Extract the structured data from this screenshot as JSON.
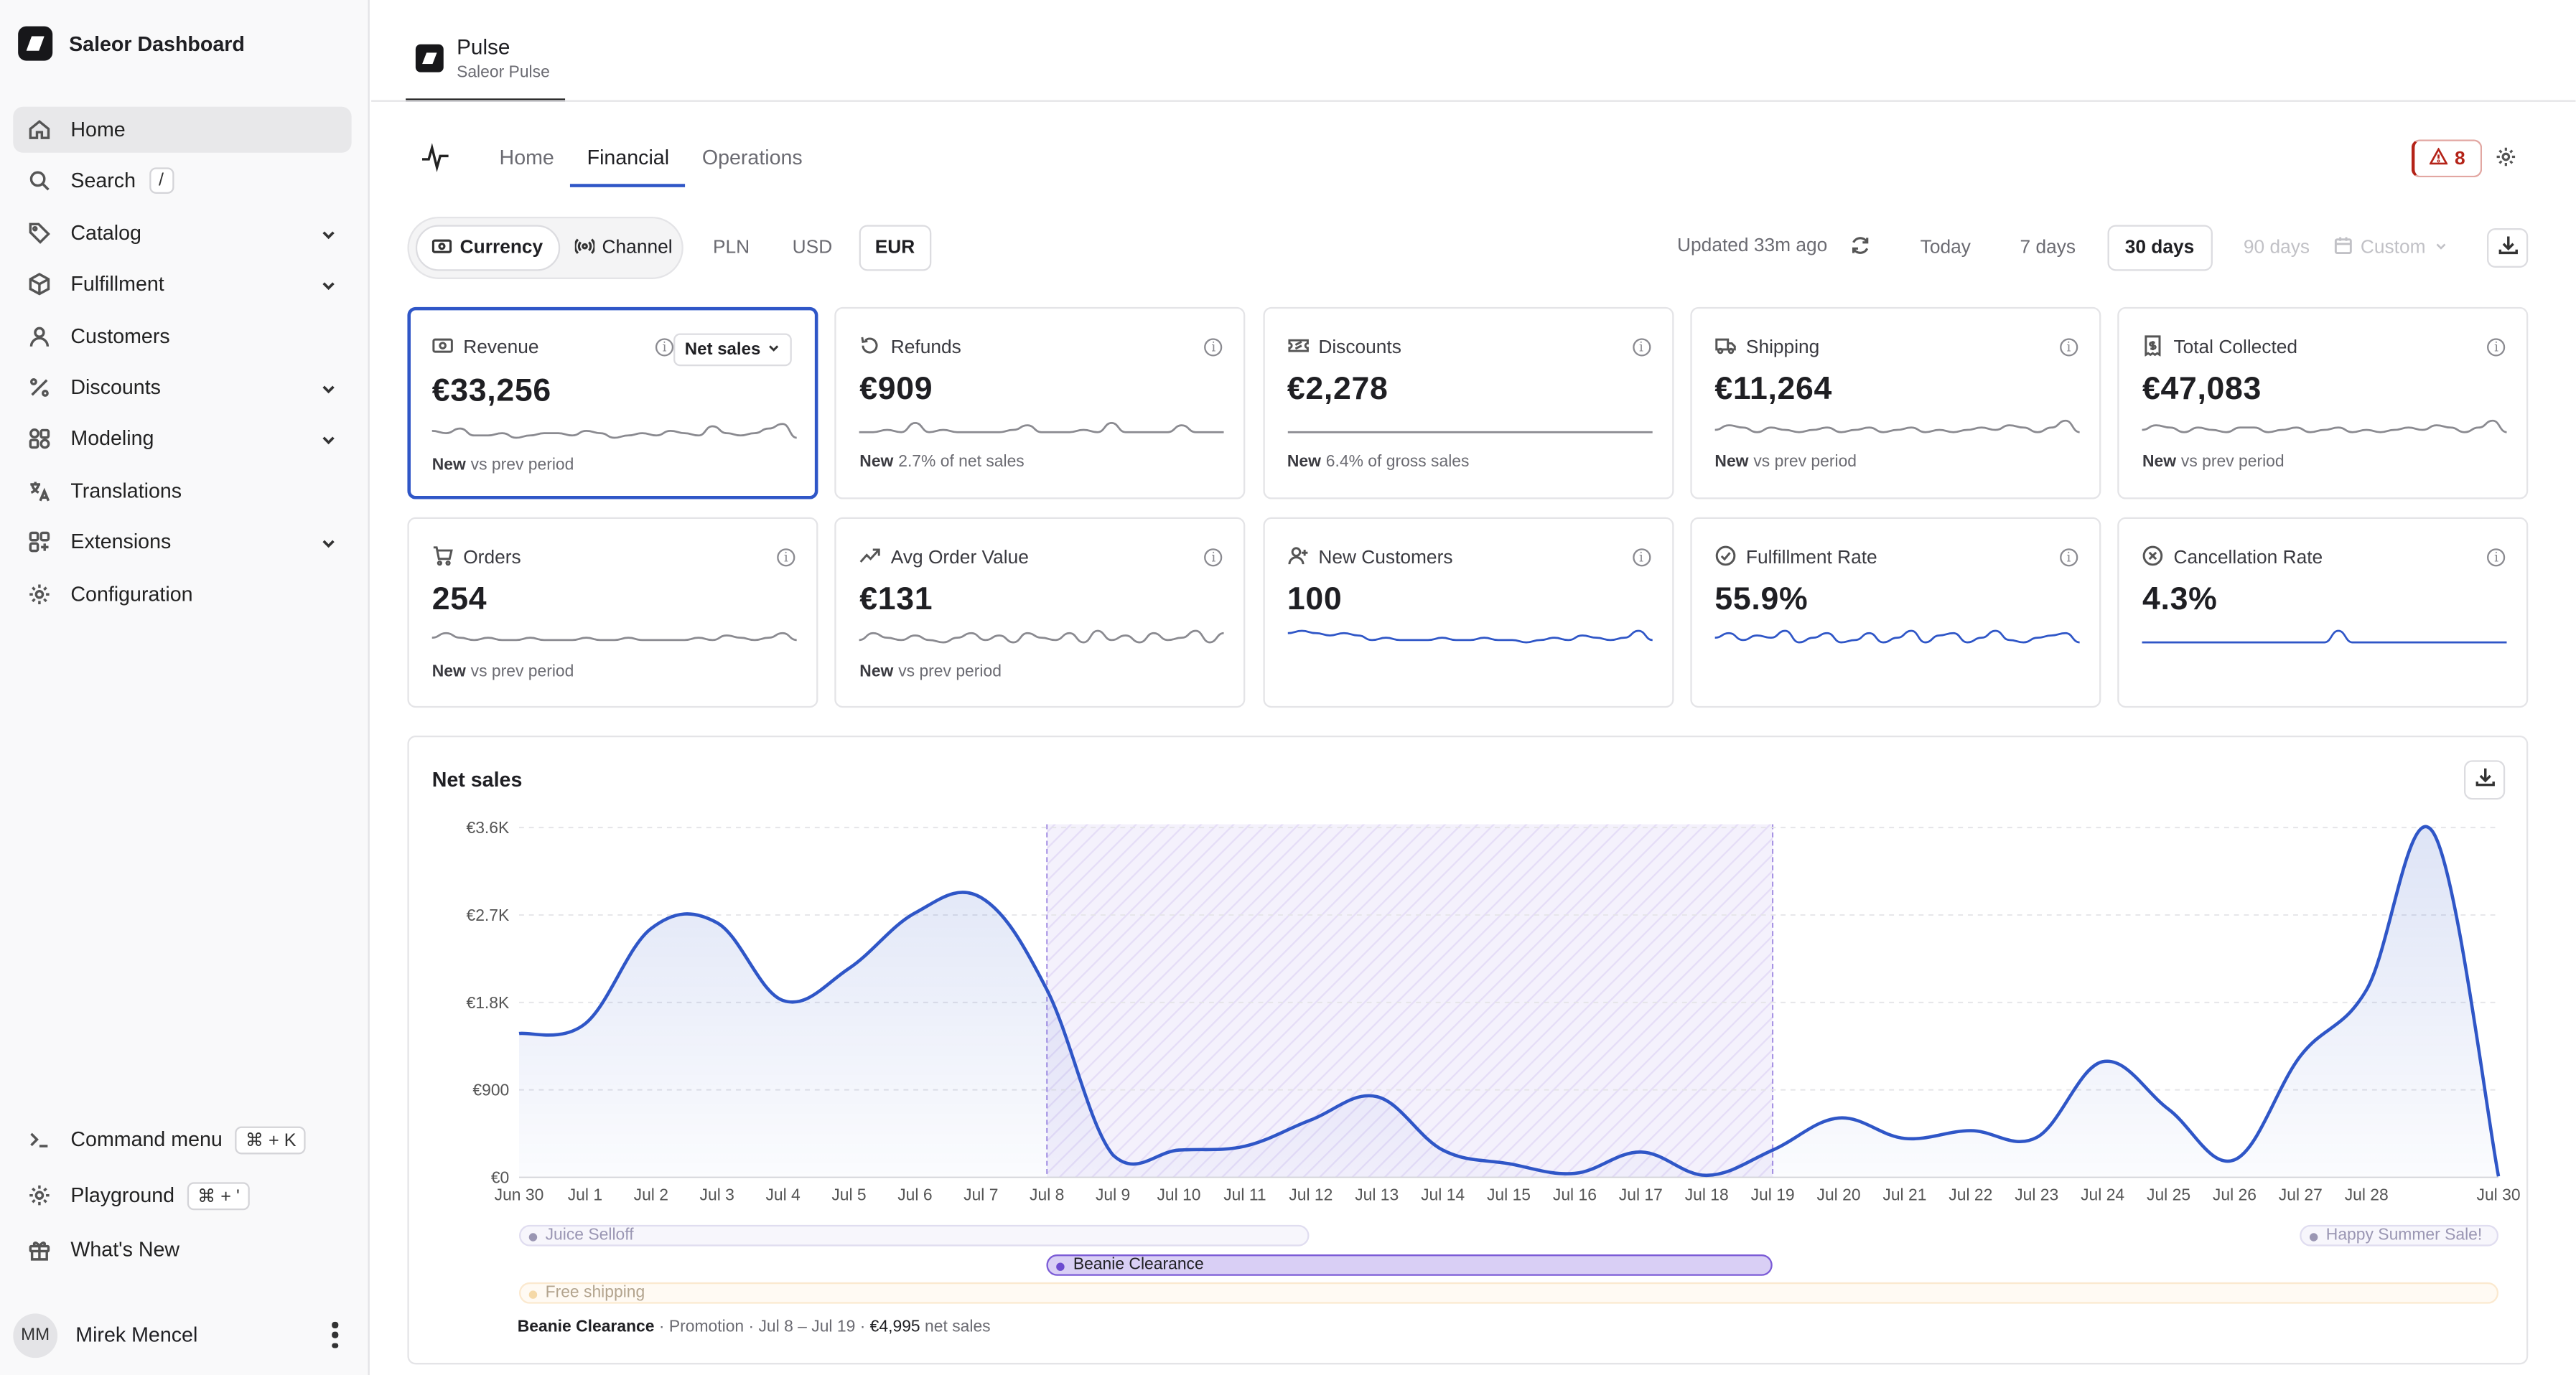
{
  "sidebar": {
    "brand": "Saleor Dashboard",
    "items": [
      {
        "label": "Home",
        "icon": "home-icon"
      },
      {
        "label": "Search",
        "icon": "search-icon",
        "kbd": "/"
      },
      {
        "label": "Catalog",
        "icon": "tag-icon"
      },
      {
        "label": "Fulfillment",
        "icon": "box-icon"
      },
      {
        "label": "Customers",
        "icon": "user-icon"
      },
      {
        "label": "Discounts",
        "icon": "percent-icon"
      },
      {
        "label": "Modeling",
        "icon": "modeling-icon"
      },
      {
        "label": "Translations",
        "icon": "language-icon"
      },
      {
        "label": "Extensions",
        "icon": "grid-plus-icon"
      },
      {
        "label": "Configuration",
        "icon": "gear-icon"
      }
    ],
    "bottom": [
      {
        "label": "Command menu",
        "kbd": "⌘ + K",
        "icon": "terminal-icon"
      },
      {
        "label": "Playground",
        "kbd": "⌘ + '",
        "icon": "gear-icon"
      },
      {
        "label": "What's New",
        "icon": "gift-icon"
      }
    ],
    "user": {
      "initials": "MM",
      "name": "Mirek Mencel"
    }
  },
  "app": {
    "title": "Pulse",
    "subtitle": "Saleor Pulse"
  },
  "tabs": [
    "Home",
    "Financial",
    "Operations"
  ],
  "alerts": {
    "count": "8"
  },
  "toggle": {
    "currency": "Currency",
    "channel": "Channel"
  },
  "currencies": [
    "PLN",
    "USD",
    "EUR"
  ],
  "updated": "Updated 33m ago",
  "periods": [
    "Today",
    "7 days",
    "30 days",
    "90 days"
  ],
  "custom": "Custom",
  "kpis": [
    {
      "label": "Revenue",
      "value": "€33,256",
      "badge": "New",
      "foot": "vs prev period",
      "select": "Net sales",
      "icon": "cash-icon",
      "color": "#8a8a90"
    },
    {
      "label": "Refunds",
      "value": "€909",
      "badge": "New",
      "foot": "2.7% of net sales",
      "icon": "refund-icon",
      "color": "#8a8a90"
    },
    {
      "label": "Discounts",
      "value": "€2,278",
      "badge": "New",
      "foot": "6.4% of gross sales",
      "icon": "ticket-icon",
      "color": "#8a8a90"
    },
    {
      "label": "Shipping",
      "value": "€11,264",
      "badge": "New",
      "foot": "vs prev period",
      "icon": "truck-icon",
      "color": "#8a8a90"
    },
    {
      "label": "Total Collected",
      "value": "€47,083",
      "badge": "New",
      "foot": "vs prev period",
      "icon": "receipt-icon",
      "color": "#8a8a90"
    },
    {
      "label": "Orders",
      "value": "254",
      "badge": "New",
      "foot": "vs prev period",
      "icon": "cart-icon",
      "color": "#8a8a90"
    },
    {
      "label": "Avg Order Value",
      "value": "€131",
      "badge": "New",
      "foot": "vs prev period",
      "icon": "trend-icon",
      "color": "#8a8a90"
    },
    {
      "label": "New Customers",
      "value": "100",
      "badge": "",
      "foot": "",
      "icon": "user-plus-icon",
      "color": "#2f56c7"
    },
    {
      "label": "Fulfillment Rate",
      "value": "55.9%",
      "badge": "",
      "foot": "",
      "icon": "check-circle-icon",
      "color": "#2f56c7"
    },
    {
      "label": "Cancellation Rate",
      "value": "4.3%",
      "badge": "",
      "foot": "",
      "icon": "x-circle-icon",
      "color": "#2f56c7"
    }
  ],
  "promotions": [
    {
      "name": "Juice Selloff",
      "start": "Jun 30",
      "end": "Jul 12"
    },
    {
      "name": "Beanie Clearance",
      "start": "Jul 8",
      "end": "Jul 19"
    },
    {
      "name": "Happy Summer Sale!",
      "start": "Jul 28",
      "end": "Jul 30"
    },
    {
      "name": "Free shipping",
      "start": "Jun 30",
      "end": "Jul 30"
    }
  ],
  "caption": {
    "name": "Beanie Clearance",
    "type": "Promotion",
    "range": "Jul 8 – Jul 19",
    "value": "€4,995",
    "suffix": "net sales"
  },
  "chart_data": {
    "type": "area",
    "title": "Net sales",
    "x": [
      "Jun 30",
      "Jul 1",
      "Jul 2",
      "Jul 3",
      "Jul 4",
      "Jul 5",
      "Jul 6",
      "Jul 7",
      "Jul 8",
      "Jul 9",
      "Jul 10",
      "Jul 11",
      "Jul 12",
      "Jul 13",
      "Jul 14",
      "Jul 15",
      "Jul 16",
      "Jul 17",
      "Jul 18",
      "Jul 19",
      "Jul 20",
      "Jul 21",
      "Jul 22",
      "Jul 23",
      "Jul 24",
      "Jul 25",
      "Jul 26",
      "Jul 27",
      "Jul 28",
      "Jul 29",
      "Jul 30"
    ],
    "xticks": [
      "Jun 30",
      "Jul 1",
      "Jul 2",
      "Jul 3",
      "Jul 4",
      "Jul 5",
      "Jul 6",
      "Jul 7",
      "Jul 8",
      "Jul 9",
      "Jul 10",
      "Jul 11",
      "Jul 12",
      "Jul 13",
      "Jul 14",
      "Jul 15",
      "Jul 16",
      "Jul 17",
      "Jul 18",
      "Jul 19",
      "Jul 20",
      "Jul 21",
      "Jul 22",
      "Jul 23",
      "Jul 24",
      "Jul 25",
      "Jul 26",
      "Jul 27",
      "Jul 28",
      "Jul 30"
    ],
    "values": [
      1480,
      1580,
      2560,
      2620,
      1820,
      2150,
      2720,
      2880,
      1930,
      230,
      280,
      320,
      590,
      830,
      280,
      140,
      40,
      260,
      20,
      280,
      610,
      400,
      480,
      410,
      1190,
      700,
      180,
      1250,
      1930,
      3560,
      10
    ],
    "yticks": [
      "€0",
      "€900",
      "€1.8K",
      "€2.7K",
      "€3.6K"
    ],
    "ylim": [
      0,
      3600
    ],
    "highlight": {
      "start": "Jul 8",
      "end": "Jul 19"
    },
    "color": "#2f56c7",
    "grid": true
  }
}
